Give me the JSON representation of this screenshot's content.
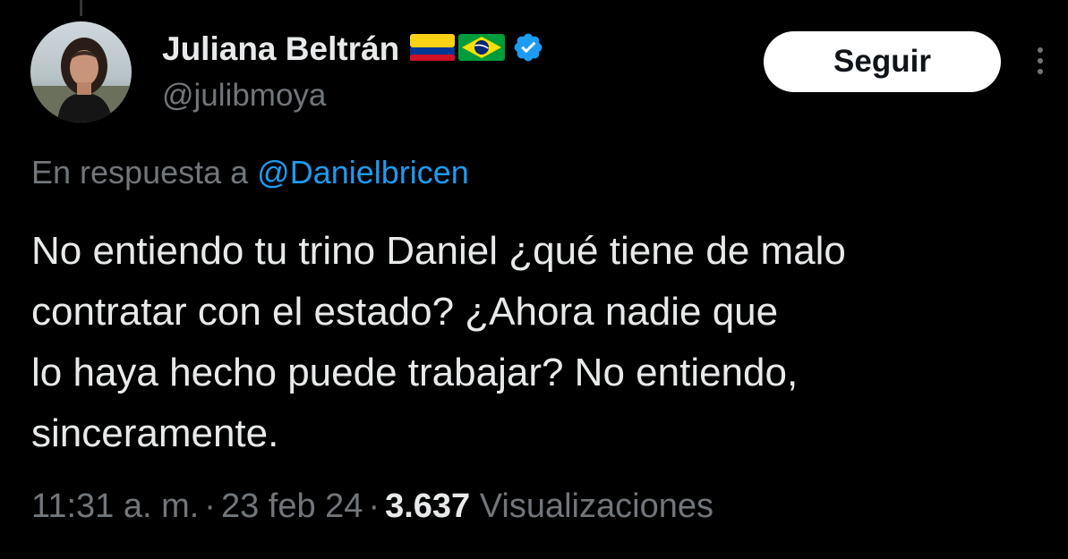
{
  "author": {
    "display_name": "Juliana Beltrán",
    "handle": "@julibmoya",
    "flags": [
      "colombia-flag-icon",
      "brazil-flag-icon"
    ],
    "verified_icon": "verified-badge-icon"
  },
  "follow_button": {
    "label": "Seguir"
  },
  "more_menu": {
    "icon": "more-vertical-icon"
  },
  "reply": {
    "prefix": "En respuesta a",
    "mention": "@Danielbricen"
  },
  "tweet": {
    "lines": [
      "No entiendo tu trino Daniel ¿qué tiene de malo",
      "contratar con el estado? ¿Ahora nadie que",
      "lo haya hecho puede trabajar? No entiendo,",
      "sinceramente."
    ]
  },
  "meta": {
    "time": "11:31 a. m.",
    "separator": "·",
    "date": "23 feb 24",
    "views_count": "3.637",
    "views_label": "Visualizaciones"
  },
  "colors": {
    "background": "#000000",
    "text": "#e7e9ea",
    "secondary": "#71767b",
    "link": "#1d9bf0",
    "verified": "#1d9bf0",
    "button_bg": "#ffffff"
  }
}
